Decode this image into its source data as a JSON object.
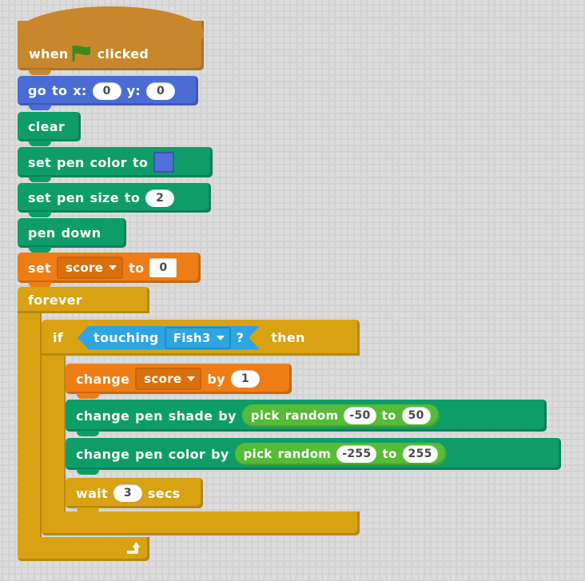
{
  "workspace": {
    "background_color": "#dddddd",
    "pattern": "plus-grid"
  },
  "palette": {
    "events": "#c8872c",
    "motion": "#4a6cd4",
    "pen": "#0e9d69",
    "data": "#ee7d16",
    "control": "#d9a213",
    "sensing": "#2ca5e2",
    "operators": "#56bb35"
  },
  "script": {
    "hat": {
      "word_when": "when",
      "icon": "green-flag-icon",
      "word_clicked": "clicked"
    },
    "goto": {
      "label_go": "go",
      "label_to": "to",
      "label_x": "x:",
      "value_x": "0",
      "label_y": "y:",
      "value_y": "0"
    },
    "clear": {
      "label": "clear"
    },
    "set_pen_color": {
      "label_set": "set",
      "label_pen": "pen",
      "label_color": "color",
      "label_to": "to",
      "swatch_color": "#5271d8"
    },
    "set_pen_size": {
      "label_set": "set",
      "label_pen": "pen",
      "label_size": "size",
      "label_to": "to",
      "value": "2"
    },
    "pen_down": {
      "label_pen": "pen",
      "label_down": "down"
    },
    "set_variable": {
      "label_set": "set",
      "variable": "score",
      "label_to": "to",
      "value": "0"
    },
    "forever": {
      "label": "forever",
      "loop_icon": "loop-arrow-icon"
    },
    "if_then": {
      "label_if": "if",
      "label_then": "then",
      "condition": {
        "label_touching": "touching",
        "target": "Fish3",
        "label_question": "?"
      }
    },
    "change_variable": {
      "label_change": "change",
      "variable": "score",
      "label_by": "by",
      "value": "1"
    },
    "change_pen_shade": {
      "label_change": "change",
      "label_pen": "pen",
      "label_shade": "shade",
      "label_by": "by",
      "operator": {
        "label_pick": "pick",
        "label_random": "random",
        "from": "-50",
        "label_to": "to",
        "until": "50"
      }
    },
    "change_pen_color": {
      "label_change": "change",
      "label_pen": "pen",
      "label_color": "color",
      "label_by": "by",
      "operator": {
        "label_pick": "pick",
        "label_random": "random",
        "from": "-255",
        "label_to": "to",
        "until": "255"
      }
    },
    "wait": {
      "label_wait": "wait",
      "value": "3",
      "label_secs": "secs"
    }
  }
}
